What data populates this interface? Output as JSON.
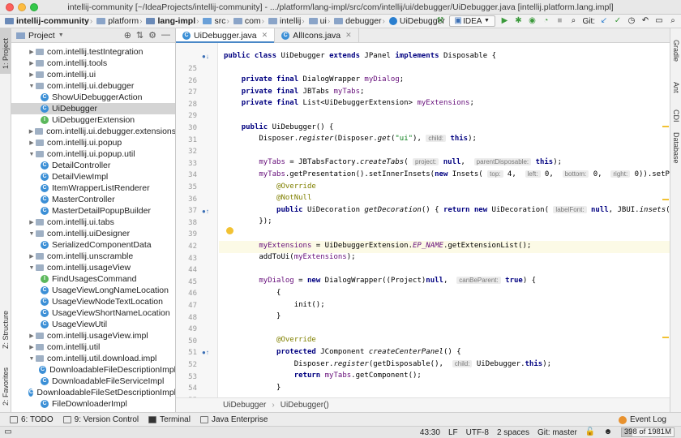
{
  "window": {
    "title": "intellij-community [~/IdeaProjects/intellij-community] - .../platform/lang-impl/src/com/intellij/ui/debugger/UiDebugger.java [intellij.platform.lang.impl]"
  },
  "navbar": {
    "crumbs": [
      "intellij-community",
      "platform",
      "lang-impl",
      "src",
      "com",
      "intellij",
      "ui",
      "debugger",
      "UiDebugger"
    ],
    "run_config": "IDEA",
    "git_label": "Git:"
  },
  "left_strip": {
    "project": "1: Project",
    "structure": "Z: Structure",
    "favorites": "2: Favorites"
  },
  "right_strip": {
    "gradle": "Gradle",
    "ant": "Ant",
    "cdi": "CDI",
    "database": "Database"
  },
  "project_panel": {
    "title": "Project",
    "tree": [
      {
        "label": "com.intellij.testIntegration",
        "kind": "package",
        "indent": 1,
        "expanded": false
      },
      {
        "label": "com.intellij.tools",
        "kind": "package",
        "indent": 1,
        "expanded": false
      },
      {
        "label": "com.intellij.ui",
        "kind": "package",
        "indent": 1,
        "expanded": false
      },
      {
        "label": "com.intellij.ui.debugger",
        "kind": "package",
        "indent": 1,
        "expanded": true
      },
      {
        "label": "ShowUiDebuggerAction",
        "kind": "class",
        "indent": 2
      },
      {
        "label": "UiDebugger",
        "kind": "class",
        "indent": 2,
        "selected": true
      },
      {
        "label": "UiDebuggerExtension",
        "kind": "interface",
        "indent": 2
      },
      {
        "label": "com.intellij.ui.debugger.extensions",
        "kind": "package",
        "indent": 1,
        "expanded": false
      },
      {
        "label": "com.intellij.ui.popup",
        "kind": "package",
        "indent": 1,
        "expanded": false
      },
      {
        "label": "com.intellij.ui.popup.util",
        "kind": "package",
        "indent": 1,
        "expanded": true
      },
      {
        "label": "DetailController",
        "kind": "class",
        "indent": 2
      },
      {
        "label": "DetailViewImpl",
        "kind": "class",
        "indent": 2
      },
      {
        "label": "ItemWrapperListRenderer",
        "kind": "class",
        "indent": 2
      },
      {
        "label": "MasterController",
        "kind": "class",
        "indent": 2
      },
      {
        "label": "MasterDetailPopupBuilder",
        "kind": "class",
        "indent": 2
      },
      {
        "label": "com.intellij.ui.tabs",
        "kind": "package",
        "indent": 1,
        "expanded": false
      },
      {
        "label": "com.intellij.uiDesigner",
        "kind": "package",
        "indent": 1,
        "expanded": true
      },
      {
        "label": "SerializedComponentData",
        "kind": "class",
        "indent": 2
      },
      {
        "label": "com.intellij.unscramble",
        "kind": "package",
        "indent": 1,
        "expanded": false
      },
      {
        "label": "com.intellij.usageView",
        "kind": "package",
        "indent": 1,
        "expanded": true
      },
      {
        "label": "FindUsagesCommand",
        "kind": "interface",
        "indent": 2
      },
      {
        "label": "UsageViewLongNameLocation",
        "kind": "class",
        "indent": 2
      },
      {
        "label": "UsageViewNodeTextLocation",
        "kind": "class",
        "indent": 2
      },
      {
        "label": "UsageViewShortNameLocation",
        "kind": "class",
        "indent": 2
      },
      {
        "label": "UsageViewUtil",
        "kind": "class",
        "indent": 2
      },
      {
        "label": "com.intellij.usageView.impl",
        "kind": "package",
        "indent": 1,
        "expanded": false
      },
      {
        "label": "com.intellij.util",
        "kind": "package",
        "indent": 1,
        "expanded": false
      },
      {
        "label": "com.intellij.util.download.impl",
        "kind": "package",
        "indent": 1,
        "expanded": true
      },
      {
        "label": "DownloadableFileDescriptionImpl",
        "kind": "class",
        "indent": 2
      },
      {
        "label": "DownloadableFileServiceImpl",
        "kind": "class",
        "indent": 2
      },
      {
        "label": "DownloadableFileSetDescriptionImpl",
        "kind": "class",
        "indent": 2
      },
      {
        "label": "FileDownloaderImpl",
        "kind": "class",
        "indent": 2
      }
    ]
  },
  "editor": {
    "tabs": [
      {
        "label": "UiDebugger.java",
        "active": true
      },
      {
        "label": "AllIcons.java",
        "active": false
      }
    ],
    "current_line": 43,
    "lines": [
      {
        "n": 25,
        "html": "<span class='kw'>public class</span> UiDebugger <span class='kw'>extends</span> JPanel <span class='kw'>implements</span> Disposable {"
      },
      {
        "n": 26,
        "html": ""
      },
      {
        "n": 27,
        "html": "    <span class='kw'>private final</span> DialogWrapper <span class='fld'>myDialog</span>;"
      },
      {
        "n": 28,
        "html": "    <span class='kw'>private final</span> JBTabs <span class='fld'>myTabs</span>;"
      },
      {
        "n": 29,
        "html": "    <span class='kw'>private final</span> List&lt;UiDebuggerExtension&gt; <span class='fld'>myExtensions</span>;"
      },
      {
        "n": 30,
        "html": ""
      },
      {
        "n": 31,
        "html": "    <span class='kw'>public</span> UiDebugger() {"
      },
      {
        "n": 32,
        "html": "        Disposer.<span class='ital'>register</span>(Disposer.<span class='ital'>get</span>(<span class='str'>\"ui\"</span>), <span class='hint'>child:</span> <span class='kw'>this</span>);"
      },
      {
        "n": 33,
        "html": ""
      },
      {
        "n": 34,
        "html": "        <span class='fld'>myTabs</span> = JBTabsFactory.<span class='ital'>createTabs</span>( <span class='hint'>project:</span> <span class='kw'>null</span>,  <span class='hint'>parentDisposable:</span> <span class='kw'>this</span>);"
      },
      {
        "n": 35,
        "html": "        <span class='fld'>myTabs</span>.getPresentation().setInnerInsets(<span class='kw'>new</span> Insets( <span class='hint'>top:</span> 4,  <span class='hint'>left:</span> 0,  <span class='hint'>bottom:</span> 0,  <span class='hint'>right:</span> 0)).setPaintBorder( <span class='hint'>top:</span> 1,"
      },
      {
        "n": 36,
        "html": "            <span class='ann'>@Override</span>"
      },
      {
        "n": 37,
        "html": "            <span class='ann'>@NotNull</span>"
      },
      {
        "n": 38,
        "html": "            <span class='kw'>public</span> UiDecoration <span class='ital'>getDecoration</span>() { <span class='kw'>return new</span> UiDecoration( <span class='hint'>labelFont:</span> <span class='kw'>null</span>, JBUI.<span class='ital'>insets</span>( <span class='hint'>all:</span> 4)); }"
      },
      {
        "n": 39,
        "html": "        });"
      },
      {
        "n": 42,
        "html": ""
      },
      {
        "n": 43,
        "html": "        <span class='fld'>myExtensions</span> = UiDebuggerExtension.<span class='fld ital'>EP_NAME</span>.getExtensionList();"
      },
      {
        "n": 44,
        "html": "        addToUi(<span class='fld'>myExtensions</span>);"
      },
      {
        "n": 45,
        "html": ""
      },
      {
        "n": 46,
        "html": "        <span class='fld'>myDialog</span> = <span class='kw'>new</span> DialogWrapper((Project)<span class='kw'>null</span>,  <span class='hint'>canBeParent:</span> <span class='kw'>true</span>) {"
      },
      {
        "n": 47,
        "html": "            {"
      },
      {
        "n": 48,
        "html": "                init();"
      },
      {
        "n": 49,
        "html": "            }"
      },
      {
        "n": 50,
        "html": ""
      },
      {
        "n": 51,
        "html": "            <span class='ann'>@Override</span>"
      },
      {
        "n": 52,
        "html": "            <span class='kw'>protected</span> JComponent <span class='ital'>createCenterPanel</span>() {"
      },
      {
        "n": 53,
        "html": "                Disposer.<span class='ital'>register</span>(getDisposable(),  <span class='hint'>child:</span> UiDebugger.<span class='kw'>this</span>);"
      },
      {
        "n": 54,
        "html": "                <span class='kw'>return</span> <span class='fld'>myTabs</span>.getComponent();"
      },
      {
        "n": 55,
        "html": "            }"
      },
      {
        "n": 56,
        "html": ""
      }
    ],
    "breadcrumb": [
      "UiDebugger",
      "UiDebugger()"
    ]
  },
  "bottom_tools": {
    "todo": "6: TODO",
    "vcs": "9: Version Control",
    "terminal": "Terminal",
    "java_ee": "Java Enterprise",
    "event_log": "Event Log"
  },
  "status": {
    "position": "43:30",
    "line_sep": "LF",
    "encoding": "UTF-8",
    "indent": "2 spaces",
    "git_branch": "Git: master",
    "memory": "398 of 1981M"
  },
  "colors": {
    "selection": "#d4d4d4",
    "current_line": "#fcfae6",
    "keyword": "#000080",
    "field": "#660e7a",
    "string": "#067d17",
    "annotation": "#808000"
  }
}
